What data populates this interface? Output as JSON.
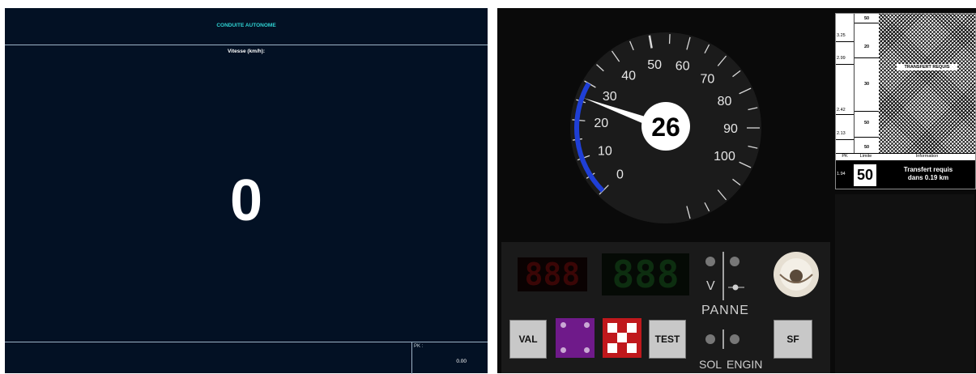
{
  "left_panel": {
    "title": "CONDUITE AUTONOME",
    "speed_label": "Vitesse (km/h):",
    "speed_value": "0",
    "pk_label": "PK :",
    "pk_value": "0.00"
  },
  "speedometer": {
    "speed_value": "26",
    "ticks": [
      "0",
      "10",
      "20",
      "30",
      "40",
      "50",
      "60",
      "70",
      "80",
      "90",
      "100"
    ],
    "needle_value": 26,
    "blue_arc_range": [
      0,
      30
    ],
    "accent_color": "#1f3fd6"
  },
  "signal_table": {
    "pk_marks": [
      "3.25",
      "2.99",
      "2.42",
      "2.13"
    ],
    "limit_values": [
      "50",
      "20",
      "30",
      "50",
      "50"
    ],
    "transfer_banner": "TRANSFERT REQUIS",
    "header": {
      "pk": "PK",
      "limit": "Limite",
      "info": "Information"
    },
    "current_pk": "1.94",
    "current_limit": "50",
    "info_line1": "Transfert requis",
    "info_line2": "dans 0.19 km"
  },
  "control_panel": {
    "display_left": "888",
    "display_right": "888",
    "v_label": "V",
    "panne_label": "PANNE",
    "sol_label": "SOL",
    "engin_label": "ENGIN",
    "buttons": {
      "val": "VAL",
      "test": "TEST",
      "sf": "SF"
    },
    "colors": {
      "display_left": "#3a0606",
      "display_right": "#0b2a0e",
      "purple": "#6f1a8a",
      "red": "#c0181c"
    }
  }
}
